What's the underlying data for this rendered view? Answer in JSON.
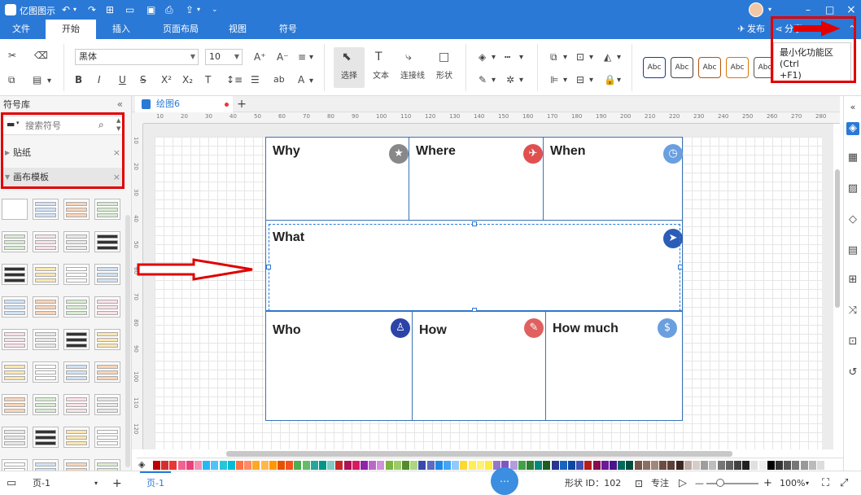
{
  "app": {
    "title": "亿图图示"
  },
  "titlebar": {
    "undo": "↶",
    "redo": "↷",
    "minimize": "–",
    "maximize": "□",
    "close": "×"
  },
  "menu": {
    "tabs": [
      "文件",
      "开始",
      "插入",
      "页面布局",
      "视图",
      "符号"
    ],
    "active_index": 1,
    "publish": "发布",
    "share": "分享"
  },
  "ribbon": {
    "font_name": "黑体",
    "font_size": "10",
    "tools": [
      "选择",
      "文本",
      "连接线",
      "形状"
    ],
    "style_boxes": [
      "Abc",
      "Abc",
      "Abc",
      "Abc",
      "Abc"
    ],
    "style_colors": [
      "#1e3a8a",
      "#444444",
      "#b45309",
      "#d97706",
      "#555555"
    ]
  },
  "tooltip": {
    "line1": "最小化功能区 (Ctrl",
    "line2": "+F1)"
  },
  "left_panel": {
    "title": "符号库",
    "search_placeholder": "搜索符号",
    "libraries": [
      {
        "label": "贴纸",
        "expanded": false
      },
      {
        "label": "画布模板",
        "expanded": true
      }
    ]
  },
  "document": {
    "tab_name": "绘图6",
    "unsaved": true
  },
  "ruler": {
    "h_ticks": [
      "10",
      "20",
      "30",
      "40",
      "50",
      "60",
      "70",
      "80",
      "90",
      "100",
      "110",
      "120",
      "130",
      "140",
      "150",
      "160",
      "170",
      "180",
      "190",
      "200",
      "210",
      "220",
      "230",
      "240",
      "250",
      "260",
      "270",
      "280"
    ],
    "v_ticks": [
      "10",
      "20",
      "30",
      "40",
      "50",
      "60",
      "70",
      "80",
      "90",
      "100",
      "110",
      "120"
    ]
  },
  "diagram": {
    "cells": [
      {
        "label": "Why",
        "icon": "star-icon",
        "glyph": "★",
        "color": "#888888"
      },
      {
        "label": "Where",
        "icon": "plane-icon",
        "glyph": "✈",
        "color": "#e05050"
      },
      {
        "label": "When",
        "icon": "clock-icon",
        "glyph": "◷",
        "color": "#6a9fe0"
      },
      {
        "label": "What",
        "icon": "send-icon",
        "glyph": "➤",
        "color": "#2c5cb8"
      },
      {
        "label": "Who",
        "icon": "person-icon",
        "glyph": "♙",
        "color": "#2c44a8"
      },
      {
        "label": "How",
        "icon": "pin-icon",
        "glyph": "✎",
        "color": "#e06060"
      },
      {
        "label": "How much",
        "icon": "money-bag-icon",
        "glyph": "$",
        "color": "#6a9fe0"
      }
    ]
  },
  "right_bar": {
    "icons": [
      "fill-icon",
      "grid-icon",
      "image-icon",
      "layers-icon",
      "page-icon",
      "data-icon",
      "shuffle-icon",
      "presentation-icon",
      "history-icon"
    ]
  },
  "palette": {
    "colors": [
      "#c00000",
      "#d32f2f",
      "#e53935",
      "#f06292",
      "#ec407a",
      "#f48fb1",
      "#29b6f6",
      "#4fc3f7",
      "#26c6da",
      "#00bcd4",
      "#ff7043",
      "#ff8a65",
      "#ffa726",
      "#ffb74d",
      "#ff9800",
      "#e65100",
      "#f4511e",
      "#4caf50",
      "#66bb6a",
      "#26a69a",
      "#009688",
      "#80cbc4",
      "#c62828",
      "#ad1457",
      "#d81b60",
      "#8e24aa",
      "#ba68c8",
      "#ce93d8",
      "#7cb342",
      "#9ccc65",
      "#558b2f",
      "#aed581",
      "#3949ab",
      "#5c6bc0",
      "#1e88e5",
      "#42a5f5",
      "#90caf9",
      "#fdd835",
      "#ffee58",
      "#fff176",
      "#ffeb3b",
      "#9575cd",
      "#7e57c2",
      "#b39ddb",
      "#43a047",
      "#2e7d32",
      "#00897b",
      "#1b5e20",
      "#283593",
      "#1565c0",
      "#0d47a1",
      "#3f51b5",
      "#b71c1c",
      "#880e4f",
      "#6a1b9a",
      "#4a148c",
      "#00695c",
      "#004d40",
      "#795548",
      "#8d6e63",
      "#a1887f",
      "#6d4c41",
      "#5d4037",
      "#3e2723",
      "#bcaaa4",
      "#d7ccc8",
      "#9e9e9e",
      "#bdbdbd",
      "#757575",
      "#616161",
      "#424242",
      "#212121",
      "#e0e0e0",
      "#eeeeee",
      "#000000",
      "#333333",
      "#555555",
      "#777777",
      "#999999",
      "#bbbbbb",
      "#dddddd",
      "#ffffff"
    ]
  },
  "status": {
    "page_selector": "页-1",
    "page_tab": "页-1",
    "shape_id_label": "形状 ID：102",
    "focus_label": "专注",
    "zoom": "100%",
    "zoom_out": "—",
    "zoom_in": "+"
  }
}
